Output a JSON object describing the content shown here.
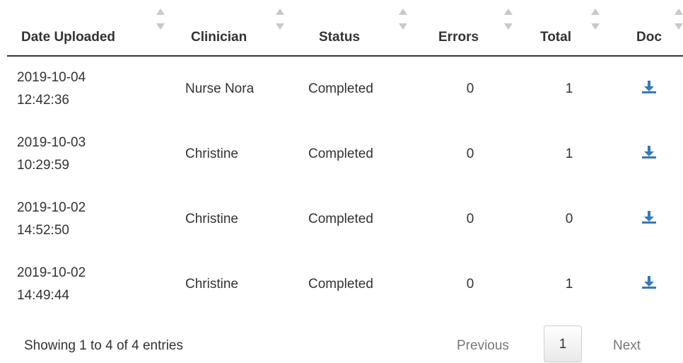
{
  "table": {
    "columns": [
      {
        "label": "Date Uploaded"
      },
      {
        "label": "Clinician"
      },
      {
        "label": "Status"
      },
      {
        "label": "Errors"
      },
      {
        "label": "Total"
      },
      {
        "label": "Doc"
      }
    ],
    "rows": [
      {
        "date": "2019-10-04",
        "time": "12:42:36",
        "clinician": "Nurse Nora",
        "status": "Completed",
        "errors": "0",
        "total": "1",
        "doc_icon": "download-icon"
      },
      {
        "date": "2019-10-03",
        "time": "10:29:59",
        "clinician": "Christine",
        "status": "Completed",
        "errors": "0",
        "total": "1",
        "doc_icon": "download-icon"
      },
      {
        "date": "2019-10-02",
        "time": "14:52:50",
        "clinician": "Christine",
        "status": "Completed",
        "errors": "0",
        "total": "0",
        "doc_icon": "download-icon"
      },
      {
        "date": "2019-10-02",
        "time": "14:49:44",
        "clinician": "Christine",
        "status": "Completed",
        "errors": "0",
        "total": "1",
        "doc_icon": "download-icon"
      }
    ]
  },
  "footer": {
    "info": "Showing 1 to 4 of 4 entries",
    "pagination": {
      "previous": "Previous",
      "current_page": "1",
      "next": "Next"
    }
  },
  "colors": {
    "icon": "#337ab7",
    "sort_arrow": "#c9c9c9",
    "header_rule": "#333333"
  }
}
